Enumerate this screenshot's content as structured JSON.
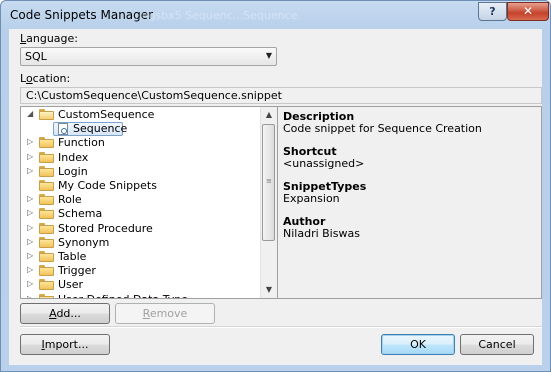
{
  "window": {
    "title": "Code Snippets Manager",
    "title_ghost": "...ngsbx5 Sequenc...Sequence.",
    "help_label": "?",
    "close_label": "✕"
  },
  "language": {
    "label_underlined": "L",
    "label_rest": "anguage:",
    "value": "SQL"
  },
  "location": {
    "label_first": "L",
    "label_underlined": "o",
    "label_rest": "cation:",
    "value": "C:\\CustomSequence\\CustomSequence.snippet"
  },
  "tree": [
    {
      "label": "CustomSequence",
      "expanded": true,
      "level": 0
    },
    {
      "label": "Sequence",
      "selected": true,
      "level": 1
    },
    {
      "label": "Function",
      "level": 0
    },
    {
      "label": "Index",
      "level": 0
    },
    {
      "label": "Login",
      "level": 0
    },
    {
      "label": "My Code Snippets",
      "level": 0,
      "no_expander": true
    },
    {
      "label": "Role",
      "level": 0
    },
    {
      "label": "Schema",
      "level": 0
    },
    {
      "label": "Stored Procedure",
      "level": 0
    },
    {
      "label": "Synonym",
      "level": 0
    },
    {
      "label": "Table",
      "level": 0
    },
    {
      "label": "Trigger",
      "level": 0
    },
    {
      "label": "User",
      "level": 0
    },
    {
      "label": "User Defined Data Type",
      "level": 0
    }
  ],
  "details": {
    "description_heading": "Description",
    "description_value": "Code snippet for Sequence Creation",
    "shortcut_heading": "Shortcut",
    "shortcut_value": "<unassigned>",
    "types_heading": "SnippetTypes",
    "types_value": "Expansion",
    "author_heading": "Author",
    "author_value": "Niladri Biswas"
  },
  "buttons": {
    "add_ul": "A",
    "add_rest": "dd...",
    "remove_ul": "R",
    "remove_rest": "emove",
    "import_ul": "I",
    "import_rest": "mport...",
    "ok": "OK",
    "cancel": "Cancel"
  }
}
